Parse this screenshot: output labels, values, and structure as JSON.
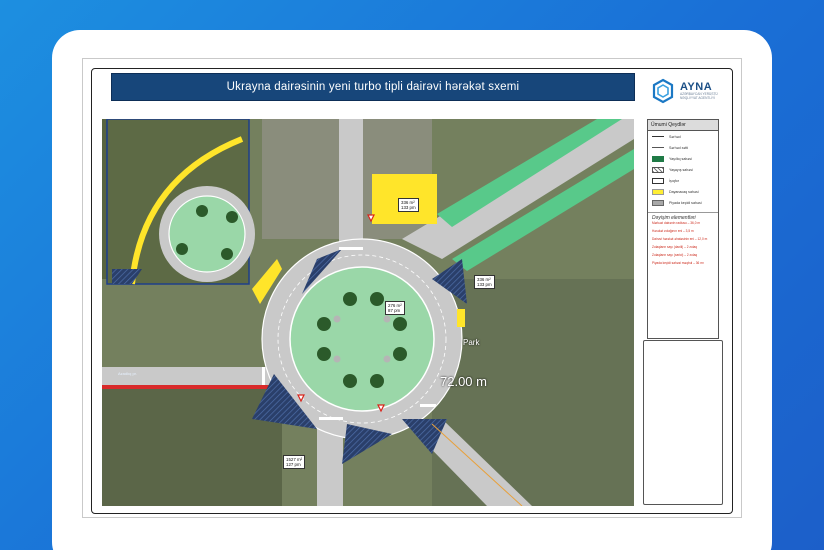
{
  "slide": {
    "title": "Ukrayna dairəsinin yeni turbo tipli dairəvi hərəkət sxemi"
  },
  "logo": {
    "name": "AYNA",
    "subtitle": "AZƏRBAYCAN YERÜSTÜ NƏQLİYYAT AGENTLİYİ"
  },
  "legend": {
    "title": "Ümumi Qeydlər",
    "items": [
      {
        "label": "Sərhəd",
        "color": "#333333",
        "kind": "line"
      },
      {
        "label": "Sərhəd xətti",
        "color": "#555555",
        "kind": "line"
      },
      {
        "label": "Yaşıllıq sahəsi",
        "color": "#1f7a46",
        "kind": "fill"
      },
      {
        "label": "Yaşayış sahəsi",
        "color": "#9a9a9a",
        "kind": "hatch"
      },
      {
        "label": "İşıqfor",
        "color": "#ffffff",
        "kind": "box"
      },
      {
        "label": "Dayanacaq sahəsi",
        "color": "#ffee33",
        "kind": "fill"
      },
      {
        "label": "Piyada keçidi sahəsi",
        "color": "#a8a8a8",
        "kind": "fill"
      }
    ],
    "sub_title": "Dəyişim elementləri",
    "notes": [
      "Mərkəzi dairənin radiusu – 36,0 m",
      "Hərəkət zolağının eni – 3,5 m",
      "Dairəvi hərəkət əhatəsinin eni – 12,0 m",
      "Zolaqların sayı (daxili) – 2 zolaq",
      "Zolaqların sayı (xarici) – 2 zolaq",
      "Piyada keçidi sahəsi məqbul – 36 m²"
    ]
  },
  "map": {
    "distance_label": "72.00 m",
    "park_label": "Park",
    "road_label": "Azadlıq pr.",
    "area_tags": [
      {
        "line1": "336 m²",
        "line2": "133 pm"
      },
      {
        "line1": "336 m²",
        "line2": "133 pm"
      },
      {
        "line1": "276 m²",
        "line2": "87 pm"
      },
      {
        "line1": "1527 m²",
        "line2": "127 pm"
      }
    ]
  }
}
